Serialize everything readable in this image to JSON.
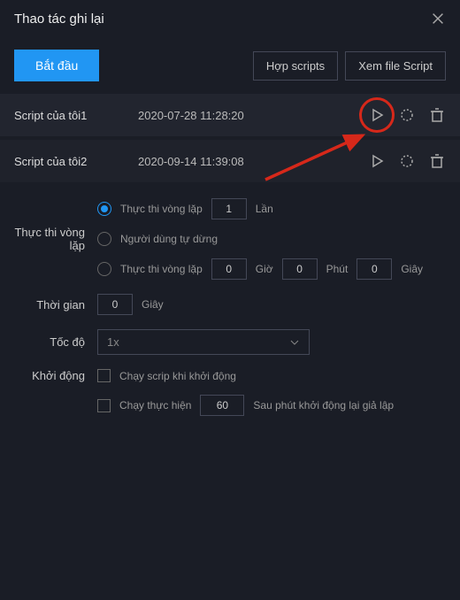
{
  "window": {
    "title": "Thao tác ghi lại"
  },
  "toolbar": {
    "start": "Bắt đầu",
    "merge": "Hợp scripts",
    "view": "Xem file Script"
  },
  "scripts": [
    {
      "name": "Script của tôi1",
      "time": "2020-07-28 11:28:20"
    },
    {
      "name": "Script của tôi2",
      "time": "2020-09-14 11:39:08"
    }
  ],
  "settings": {
    "loop": {
      "label": "Thực thi vòng lặp",
      "opt1": "Thực thi vòng lặp",
      "opt1_count": "1",
      "opt1_unit": "Lần",
      "opt2": "Người dùng tự dừng",
      "opt3": "Thực thi vòng lặp",
      "hours": "0",
      "hours_label": "Giờ",
      "minutes": "0",
      "minutes_label": "Phút",
      "seconds": "0",
      "seconds_label": "Giây"
    },
    "time": {
      "label": "Thời gian",
      "value": "0",
      "unit": "Giây"
    },
    "speed": {
      "label": "Tốc độ",
      "value": "1x"
    },
    "startup": {
      "label": "Khởi động",
      "check1": "Chạy scrip khi khởi động",
      "check2": "Chạy thực hiện",
      "check2_value": "60",
      "check2_suffix": "Sau phút khởi động lại giả lập"
    }
  }
}
